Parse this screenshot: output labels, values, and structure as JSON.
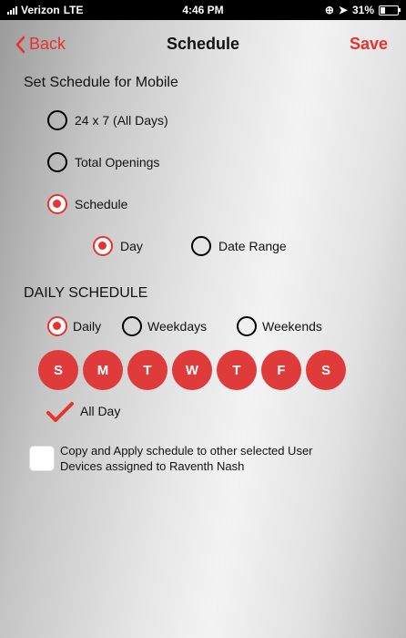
{
  "status_bar": {
    "carrier": "Verizon",
    "network": "LTE",
    "time": "4:46 PM",
    "battery": "31%",
    "battery_level": 0.31
  },
  "nav": {
    "back_label": "Back",
    "title": "Schedule",
    "save_label": "Save"
  },
  "set_schedule": {
    "title": "Set Schedule for Mobile",
    "options": [
      {
        "label": "24 x 7 (All Days)",
        "selected": false
      },
      {
        "label": "Total Openings",
        "selected": false
      },
      {
        "label": "Schedule",
        "selected": true
      }
    ],
    "sub_options": [
      {
        "label": "Day",
        "selected": true
      },
      {
        "label": "Date Range",
        "selected": false
      }
    ]
  },
  "daily_schedule": {
    "title": "DAILY SCHEDULE",
    "options": [
      {
        "label": "Daily",
        "selected": true
      },
      {
        "label": "Weekdays",
        "selected": false
      },
      {
        "label": "Weekends",
        "selected": false
      }
    ],
    "days": [
      "S",
      "M",
      "T",
      "W",
      "T",
      "F",
      "S"
    ]
  },
  "all_day": {
    "label": "All Day",
    "checked": true
  },
  "copy_apply": {
    "line1": "Copy and Apply schedule to other selected User",
    "line2": "Devices assigned to Raventh  Nash",
    "checked": false
  },
  "colors": {
    "accent": "#e8322e",
    "day_circle": "#df3b3b"
  }
}
